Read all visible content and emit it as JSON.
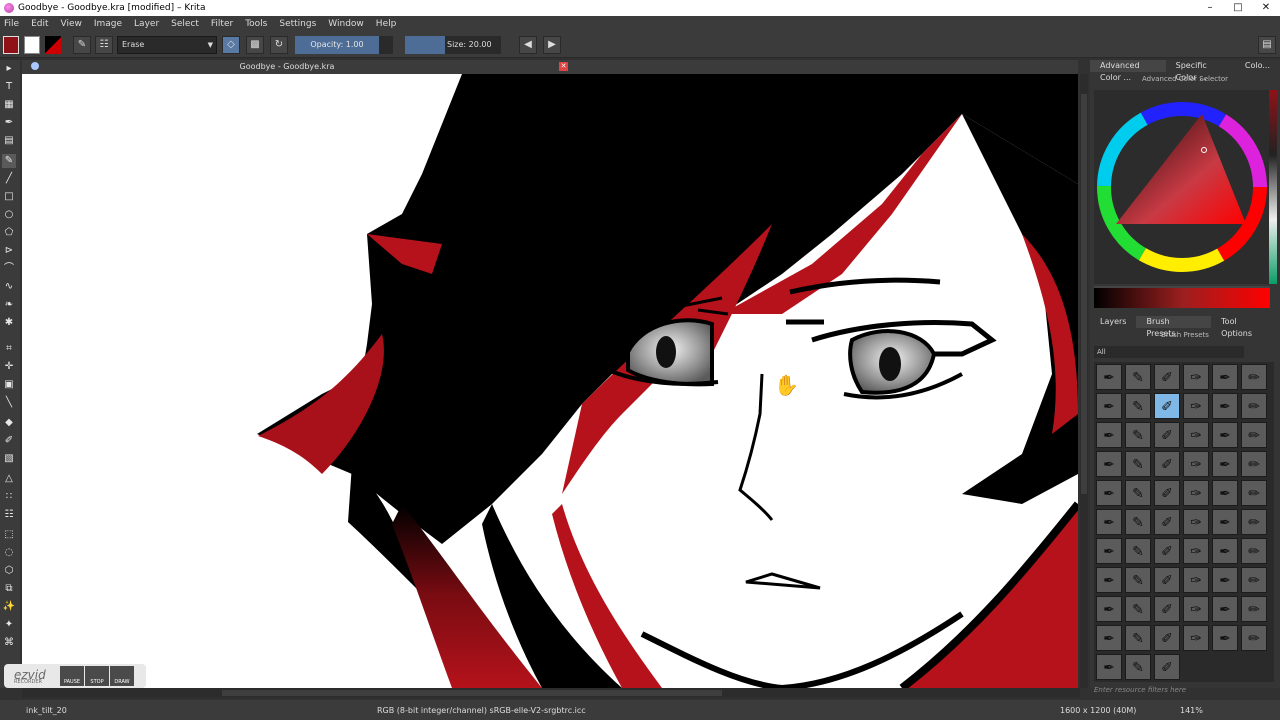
{
  "window": {
    "title": "Goodbye - Goodbye.kra [modified] – Krita",
    "controls": [
      "–",
      "□",
      "✕"
    ]
  },
  "menu": [
    "File",
    "Edit",
    "View",
    "Image",
    "Layer",
    "Select",
    "Filter",
    "Tools",
    "Settings",
    "Window",
    "Help"
  ],
  "toolbar": {
    "blend_mode": "Erase",
    "opacity": "Opacity: 1.00",
    "size": "Size: 20.00 px"
  },
  "document": {
    "tab_title": "Goodbye - Goodbye.kra"
  },
  "dock": {
    "top_tabs": [
      "Advanced Color ...",
      "Specific Color ...",
      "Colo..."
    ],
    "color_panel_title": "Advanced Color Selector",
    "bottom_tabs": [
      "Layers",
      "Brush Presets",
      "Tool Options"
    ],
    "brush_panel_title": "Brush Presets",
    "tag_filter": "All",
    "resource_filter_placeholder": "Enter resource filters here"
  },
  "ezvid": {
    "logo": "ezvid",
    "logo_sub": "RECORDER",
    "buttons": [
      "PAUSE",
      "STOP",
      "DRAW"
    ]
  },
  "status": {
    "brush": "ink_tilt_20",
    "color_profile": "RGB (8-bit integer/channel)  sRGB-elle-V2-srgbtrc.icc",
    "image_size": "1600 x 1200 (40M)",
    "zoom": "141%"
  },
  "colors": {
    "foreground": "#8f1218",
    "background": "#ffffff",
    "ui_dark": "#313131",
    "accent_slider": "#4d6d96",
    "hair_red": "#b5121b"
  }
}
